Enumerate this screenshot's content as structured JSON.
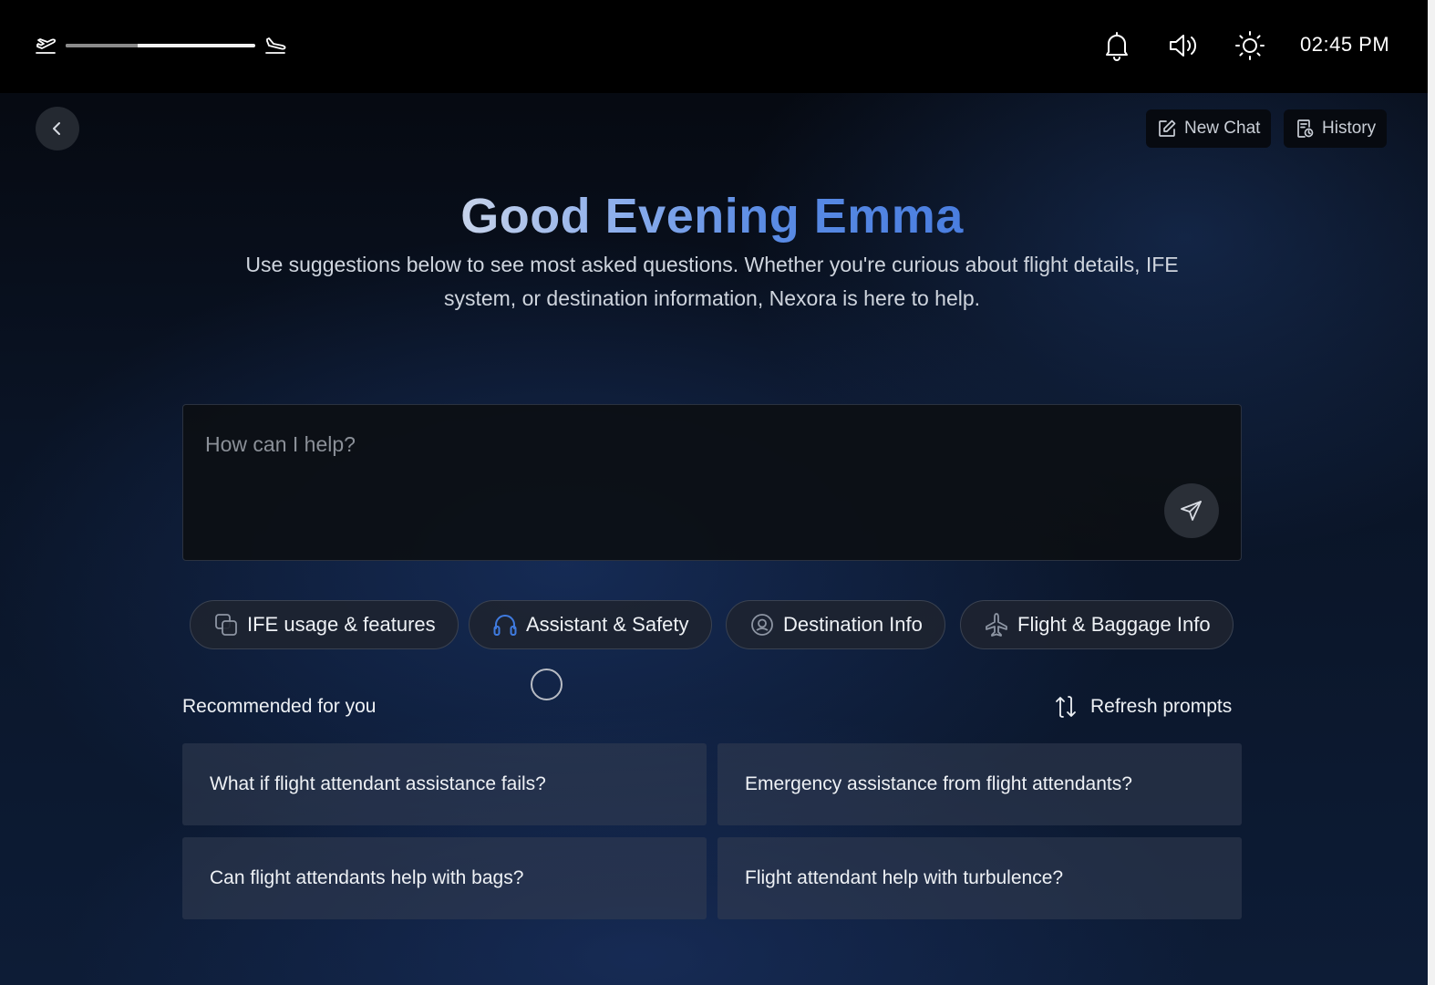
{
  "status_bar": {
    "flight_progress": 0.38,
    "clock": "02:45 PM",
    "icons": [
      "plane-departure-icon",
      "plane-arrival-icon",
      "bell-icon",
      "speaker-icon",
      "brightness-icon"
    ]
  },
  "header": {
    "new_chat_label": "New Chat",
    "history_label": "History"
  },
  "greeting": {
    "title": "Good Evening Emma",
    "subtitle": "Use suggestions below to see most asked questions. Whether you're curious about flight details, IFE system, or destination information, Nexora is here to help."
  },
  "prompt": {
    "placeholder": "How can I help?"
  },
  "categories": [
    {
      "label": "IFE usage & features",
      "icon": "copy-icon"
    },
    {
      "label": "Assistant & Safety",
      "icon": "headset-icon"
    },
    {
      "label": "Destination Info",
      "icon": "location-pin-icon"
    },
    {
      "label": "Flight & Baggage Info",
      "icon": "airplane-icon"
    }
  ],
  "recommended": {
    "title": "Recommended for you",
    "refresh_label": "Refresh prompts",
    "items": [
      "What if flight attendant assistance fails?",
      "Emergency assistance from flight attendants?",
      "Can flight attendants help with bags?",
      "Flight attendant help with turbulence?"
    ]
  },
  "colors": {
    "accent_blue": "#4a7ee0",
    "background": "#0a1426",
    "card": "#343e52"
  }
}
